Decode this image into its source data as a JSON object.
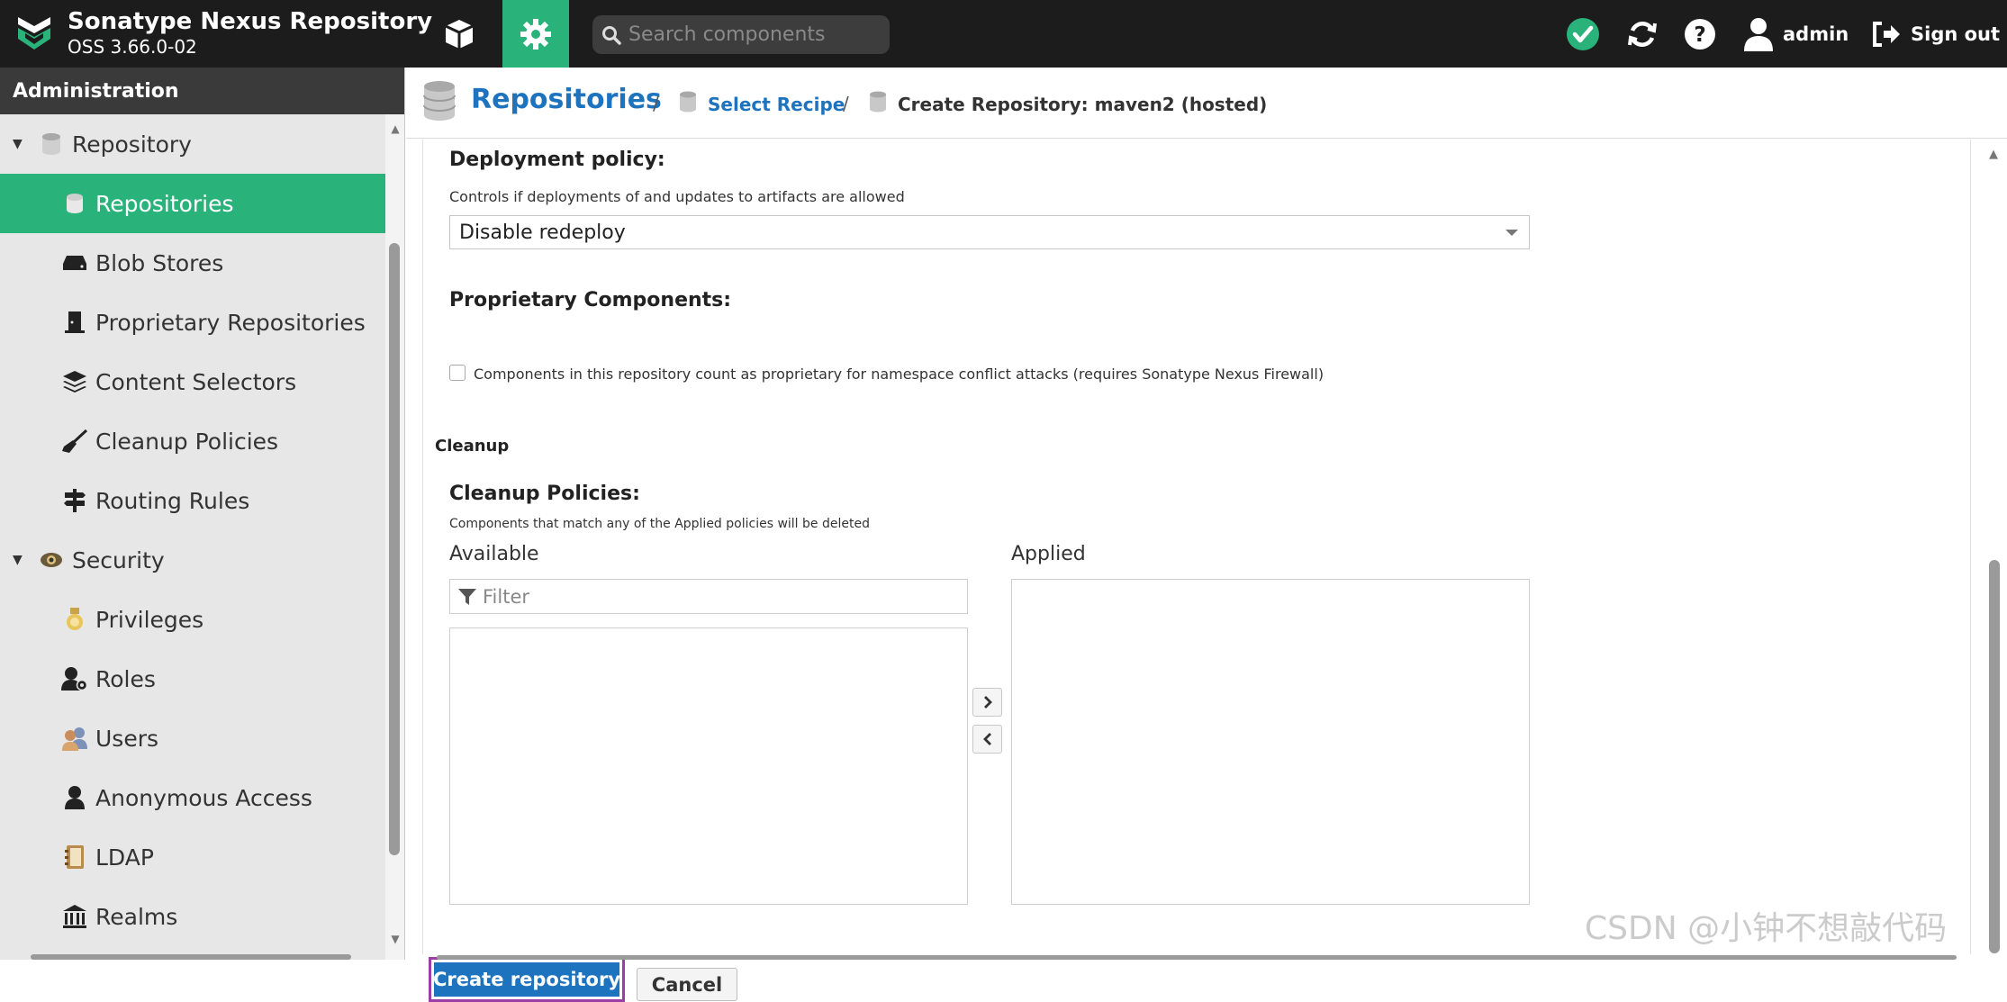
{
  "header": {
    "app_name": "Sonatype Nexus Repository",
    "version": "OSS 3.66.0-02",
    "search_placeholder": "Search components",
    "user": "admin",
    "sign_out": "Sign out",
    "accent_color": "#2ab27b"
  },
  "sidebar": {
    "title": "Administration",
    "groups": [
      {
        "label": "Repository",
        "items": [
          {
            "label": "Repositories",
            "active": true
          },
          {
            "label": "Blob Stores"
          },
          {
            "label": "Proprietary Repositories"
          },
          {
            "label": "Content Selectors"
          },
          {
            "label": "Cleanup Policies"
          },
          {
            "label": "Routing Rules"
          }
        ]
      },
      {
        "label": "Security",
        "items": [
          {
            "label": "Privileges"
          },
          {
            "label": "Roles"
          },
          {
            "label": "Users"
          },
          {
            "label": "Anonymous Access"
          },
          {
            "label": "LDAP"
          },
          {
            "label": "Realms"
          }
        ]
      }
    ]
  },
  "breadcrumb": {
    "root": "Repositories",
    "sep": "/",
    "step1": "Select Recipe",
    "current": "Create Repository: maven2 (hosted)"
  },
  "form": {
    "deployment_policy_label": "Deployment policy:",
    "deployment_policy_help": "Controls if deployments of and updates to artifacts are allowed",
    "deployment_policy_value": "Disable redeploy",
    "proprietary_label": "Proprietary Components:",
    "proprietary_checkbox_label": "Components in this repository count as proprietary for namespace conflict attacks (requires Sonatype Nexus Firewall)",
    "cleanup_section": "Cleanup",
    "cleanup_policies_label": "Cleanup Policies:",
    "cleanup_policies_help": "Components that match any of the Applied policies will be deleted",
    "available_label": "Available",
    "applied_label": "Applied",
    "filter_placeholder": "Filter",
    "create_button": "Create repository",
    "cancel_button": "Cancel"
  },
  "watermark": "CSDN @小钟不想敲代码"
}
